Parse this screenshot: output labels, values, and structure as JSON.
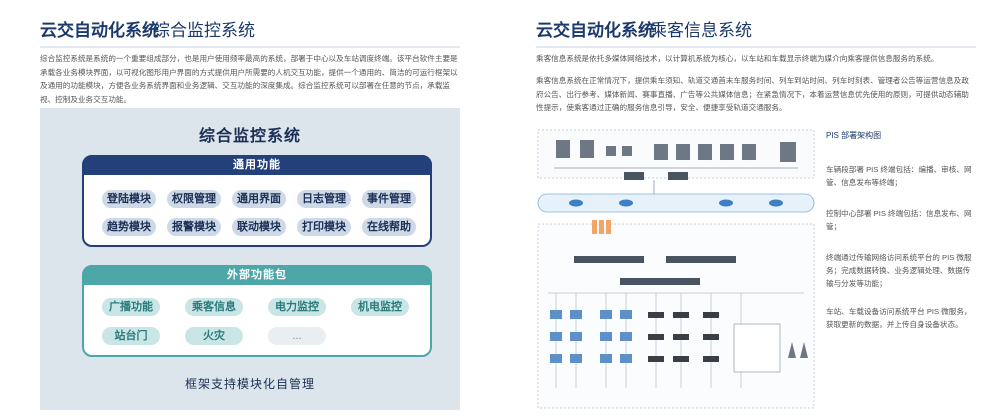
{
  "left": {
    "brand": "云交自动化系统",
    "subtitle": "综合监控系统",
    "intro": "综合监控系统是系统的一个重要组成部分，也是用户使用频率最高的系统，部署于中心以及车站调度终端。该平台软件主要是承载各业务模块界面，以可视化图形用户界面的方式提供用户所需要的人机交互功能，提供一个通用的、简洁的可运行框架以及通用的功能模块，方便各业务系统界面和业务逻辑、交互功能的深度集成。综合监控系统可以部署在任意的节点，承载监视、控制及业务交互功能。",
    "diagram_title": "综合监控系统",
    "general": {
      "header": "通用功能",
      "items": [
        "登陆模块",
        "权限管理",
        "通用界面",
        "日志管理",
        "事件管理",
        "趋势模块",
        "报警模块",
        "联动模块",
        "打印模块",
        "在线帮助"
      ]
    },
    "external": {
      "header": "外部功能包",
      "items": [
        "广播功能",
        "乘客信息",
        "电力监控",
        "机电监控",
        "站台门",
        "火灾",
        "..."
      ]
    },
    "footer": "框架支持模块化自管理"
  },
  "right": {
    "brand": "云交自动化系统",
    "subtitle": "乘客信息系统",
    "para1": "乘客信息系统是依托多媒体网络技术，以计算机系统为核心，以车站和车载显示终端为媒介向乘客提供信息服务的系统。",
    "para2": "乘客信息系统在正常情况下，提供乘车须知、轨道交通首末车服务时间、列车到站时间、列车时刻表、管理者公告等运营信息及政府公告、出行参考、媒体新闻、赛事直播、广告等公共媒体信息；在紧急情况下，本着运营信息优先使用的原则，可提供动态辅助性提示，使乘客通过正确的服务信息引导，安全、便捷享受轨道交通服务。",
    "diagram_caption": "PIS 部署架构图",
    "notes": [
      "车辆段部署 PIS 终端包括：编播、审核、网管、信息发布等终端；",
      "控制中心部署 PIS 终端包括：信息发布、网管；",
      "终端通过传输网络访问系统平台的 PIS 微服务；完成数据转换、业务逻辑处理、数据传输与分发等功能；",
      "车站、车载设备访问系统平台 PIS 微服务，获取更新的数据，并上传自身设备状态。"
    ]
  }
}
